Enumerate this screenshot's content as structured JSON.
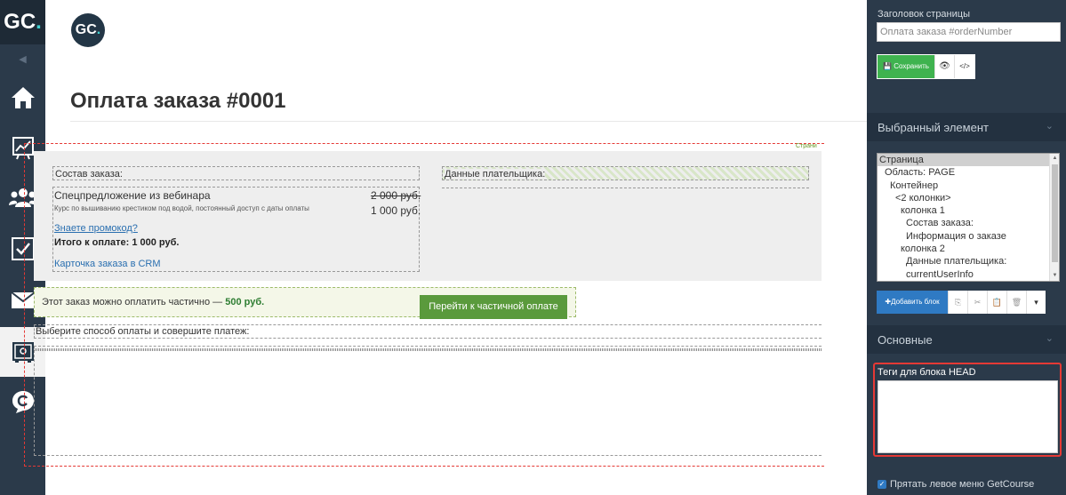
{
  "leftnav": {
    "logo": "GC",
    "logo_dot": ".",
    "collapse_icon": "◀",
    "items": [
      {
        "name": "home-icon"
      },
      {
        "name": "stats-icon"
      },
      {
        "name": "users-icon"
      },
      {
        "name": "tasks-icon"
      },
      {
        "name": "mail-icon"
      },
      {
        "name": "safe-icon"
      },
      {
        "name": "chat-icon"
      }
    ]
  },
  "main": {
    "logo": "GC",
    "logo_dot": ".",
    "title": "Оплата заказа #0001",
    "page_tag": "Страни",
    "order": {
      "col1_heading": "Состав заказа:",
      "col2_heading": "Данные плательщика:",
      "product_name": "Спецпредложение из вебинара",
      "product_desc": "Курс по вышиванию крестиком под водой, постоянный доступ с даты оплаты",
      "old_price": "2 000 руб.",
      "price": "1 000 руб.",
      "promo_link": "Знаете промокод?",
      "total": "Итого к оплате: 1 000 руб.",
      "card_link": "Карточка заказа в CRM"
    },
    "partial": {
      "text": "Этот заказ можно оплатить частично —",
      "amount": "500 руб.",
      "button": "Перейти к частичной оплате"
    },
    "payment_label": "Выберите способ оплаты и совершите платеж:"
  },
  "rpanel": {
    "page_title_label": "Заголовок страницы",
    "page_title_value": "Оплата заказа #orderNumber",
    "save_label": "Сохранить",
    "eye_icon": "👁",
    "code_icon": "</>",
    "selected_heading": "Выбранный элемент",
    "tree": [
      {
        "label": "Страница",
        "indent": 0,
        "selected": true
      },
      {
        "label": "Область: PAGE",
        "indent": 1
      },
      {
        "label": "Контейнер",
        "indent": 2
      },
      {
        "label": "<2 колонки>",
        "indent": 3
      },
      {
        "label": "колонка 1",
        "indent": 4
      },
      {
        "label": "Состав заказа:",
        "indent": 5
      },
      {
        "label": "Информация о заказе",
        "indent": 5
      },
      {
        "label": "колонка 2",
        "indent": 4
      },
      {
        "label": "Данные плательщика:",
        "indent": 5
      },
      {
        "label": "currentUserInfo",
        "indent": 5
      }
    ],
    "add_block_label": "✚Добавить блок",
    "main_heading": "Основные",
    "head_tags_label": "Теги для блока HEAD",
    "hide_menu_label": "Прятать левое меню GetCourse",
    "hide_menu_checked": true
  }
}
